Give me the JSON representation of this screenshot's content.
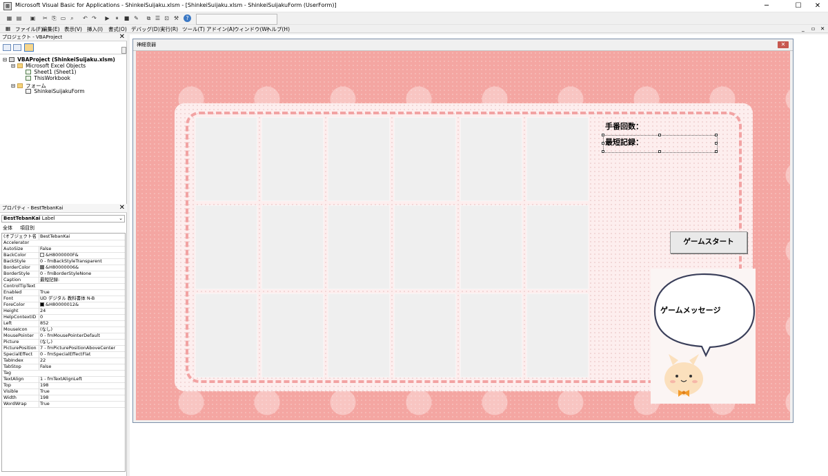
{
  "window": {
    "title": "Microsoft Visual Basic for Applications - ShinkeiSuijaku.xlsm - [ShinkeiSuijaku.xlsm - ShinkeiSuijakuForm (UserForm)]",
    "minimize": "─",
    "maximize": "☐",
    "close": "✕"
  },
  "menu": {
    "items": [
      "ファイル(F)",
      "編集(E)",
      "表示(V)",
      "挿入(I)",
      "書式(O)",
      "デバッグ(D)",
      "実行(R)",
      "ツール(T)",
      "アドイン(A)",
      "ウィンドウ(W)",
      "ヘルプ(H)"
    ]
  },
  "project_pane": {
    "title": "プロジェクト - VBAProject",
    "tree": {
      "root": "VBAProject (ShinkeiSuijaku.xlsm)",
      "excel_objects": "Microsoft Excel Objects",
      "sheet1": "Sheet1 (Sheet1)",
      "thisworkbook": "ThisWorkbook",
      "forms": "フォーム",
      "form1": "ShinkeiSuijakuForm"
    }
  },
  "properties_pane": {
    "title": "プロパティ - BestTebanKai",
    "object_name": "BestTebanKai",
    "object_type": "Label",
    "tabs": [
      "全体",
      "項目別"
    ],
    "rows": [
      {
        "name": "(オブジェクト名)",
        "value": "BestTebanKai"
      },
      {
        "name": "Accelerator",
        "value": ""
      },
      {
        "name": "AutoSize",
        "value": "False"
      },
      {
        "name": "BackColor",
        "value": "&H8000000F&"
      },
      {
        "name": "BackStyle",
        "value": "0 - fmBackStyleTransparent"
      },
      {
        "name": "BorderColor",
        "value": "&H80000006&"
      },
      {
        "name": "BorderStyle",
        "value": "0 - fmBorderStyleNone"
      },
      {
        "name": "Caption",
        "value": "最短記録:"
      },
      {
        "name": "ControlTipText",
        "value": ""
      },
      {
        "name": "Enabled",
        "value": "True"
      },
      {
        "name": "Font",
        "value": "UD デジタル 教科書体 N-B"
      },
      {
        "name": "ForeColor",
        "value": "&H80000012&"
      },
      {
        "name": "Height",
        "value": "24"
      },
      {
        "name": "HelpContextID",
        "value": "0"
      },
      {
        "name": "Left",
        "value": "852"
      },
      {
        "name": "MouseIcon",
        "value": "(なし)"
      },
      {
        "name": "MousePointer",
        "value": "0 - fmMousePointerDefault"
      },
      {
        "name": "Picture",
        "value": "(なし)"
      },
      {
        "name": "PicturePosition",
        "value": "7 - fmPicturePositionAboveCenter"
      },
      {
        "name": "SpecialEffect",
        "value": "0 - fmSpecialEffectFlat"
      },
      {
        "name": "TabIndex",
        "value": "22"
      },
      {
        "name": "TabStop",
        "value": "False"
      },
      {
        "name": "Tag",
        "value": ""
      },
      {
        "name": "TextAlign",
        "value": "1 - fmTextAlignLeft"
      },
      {
        "name": "Top",
        "value": "198"
      },
      {
        "name": "Visible",
        "value": "True"
      },
      {
        "name": "Width",
        "value": "198"
      },
      {
        "name": "WordWrap",
        "value": "True"
      }
    ],
    "swatches": {
      "BackColor": "#ffffff",
      "BorderColor": "#6d6d6d",
      "ForeColor": "#000000"
    }
  },
  "userform": {
    "caption": "神経衰弱",
    "turn_label": "手番回数：",
    "best_label": "最短記録：",
    "start_button": "ゲームスタート",
    "message": "ゲームメッセージ",
    "card_count": 18
  },
  "colors": {
    "background_pink": "#f4a6a2",
    "dashed_border": "#f2a3a3",
    "close_red": "#c7584f"
  }
}
